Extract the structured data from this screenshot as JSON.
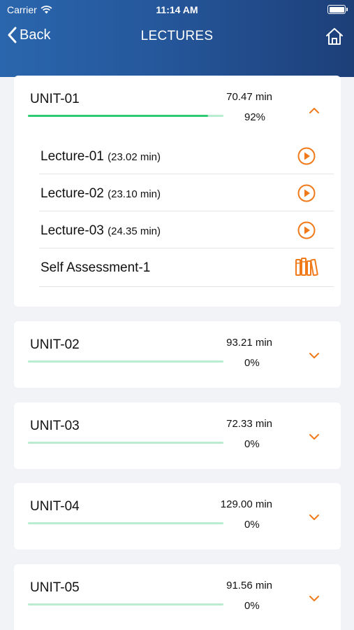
{
  "status": {
    "carrier": "Carrier",
    "time": "11:14 AM"
  },
  "nav": {
    "back_label": "Back",
    "title": "LECTURES"
  },
  "colors": {
    "accent": "#f07a1a",
    "progress": "#2ecc71",
    "progress_track": "#b9ecd0",
    "header": "#25579b"
  },
  "units": [
    {
      "title": "UNIT-01",
      "minutes": "70.47 min",
      "percent_label": "92%",
      "progress": 0.92,
      "expanded": true,
      "items": [
        {
          "name": "Lecture-01",
          "duration": "(23.02 min)",
          "icon": "play-icon"
        },
        {
          "name": "Lecture-02",
          "duration": "(23.10 min)",
          "icon": "play-icon"
        },
        {
          "name": "Lecture-03",
          "duration": "(24.35 min)",
          "icon": "play-icon"
        },
        {
          "name": "Self Assessment-1",
          "duration": "",
          "icon": "books-icon"
        }
      ]
    },
    {
      "title": "UNIT-02",
      "minutes": "93.21 min",
      "percent_label": "0%",
      "progress": 0,
      "expanded": false
    },
    {
      "title": "UNIT-03",
      "minutes": "72.33 min",
      "percent_label": "0%",
      "progress": 0,
      "expanded": false
    },
    {
      "title": "UNIT-04",
      "minutes": "129.00 min",
      "percent_label": "0%",
      "progress": 0,
      "expanded": false
    },
    {
      "title": "UNIT-05",
      "minutes": "91.56 min",
      "percent_label": "0%",
      "progress": 0,
      "expanded": false
    }
  ]
}
